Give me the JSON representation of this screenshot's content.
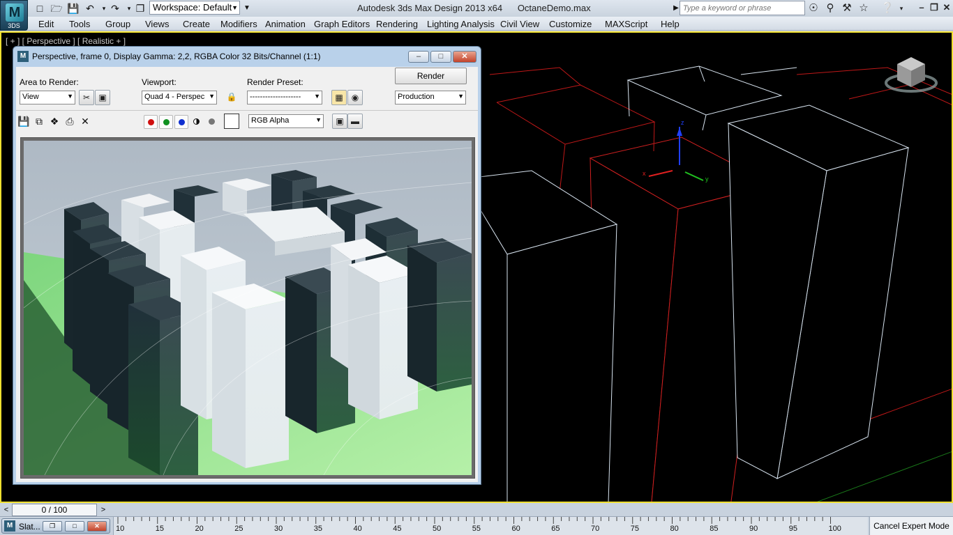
{
  "app": {
    "logo_text": "3DS",
    "title": "Autodesk 3ds Max Design 2013 x64",
    "file_name": "OctaneDemo.max",
    "workspace_label": "Workspace: Default",
    "search_placeholder": "Type a keyword or phrase"
  },
  "menu": [
    "Edit",
    "Tools",
    "Group",
    "Views",
    "Create",
    "Modifiers",
    "Animation",
    "Graph Editors",
    "Rendering",
    "Lighting Analysis",
    "Civil View",
    "Customize",
    "MAXScript",
    "Help"
  ],
  "viewport": {
    "label": "[ + ] [ Perspective ] [ Realistic + ]",
    "border_color": "#f0e030"
  },
  "render_window": {
    "title": "Perspective, frame 0, Display Gamma: 2,2, RGBA Color 32 Bits/Channel (1:1)",
    "area_to_render_label": "Area to Render:",
    "area_to_render_value": "View",
    "viewport_label": "Viewport:",
    "viewport_value": "Quad 4 - Perspec",
    "render_preset_label": "Render Preset:",
    "render_preset_value": "--------------------",
    "render_button": "Render",
    "production_value": "Production",
    "channel_value": "RGB Alpha",
    "channel_colors": {
      "red": "#d01010",
      "green": "#109020",
      "blue": "#1030d0",
      "alpha": "#777777"
    }
  },
  "timeline": {
    "frame_display": "0 / 100",
    "prev_arrow": "<",
    "next_arrow": ">",
    "ticks": [
      "10",
      "15",
      "20",
      "25",
      "30",
      "35",
      "40",
      "45",
      "50",
      "55",
      "60",
      "65",
      "70",
      "75",
      "80",
      "85",
      "90",
      "95",
      "100"
    ]
  },
  "taskbar": {
    "slate_label": "Slat..."
  },
  "status": {
    "cancel_expert": "Cancel Expert Mode"
  }
}
